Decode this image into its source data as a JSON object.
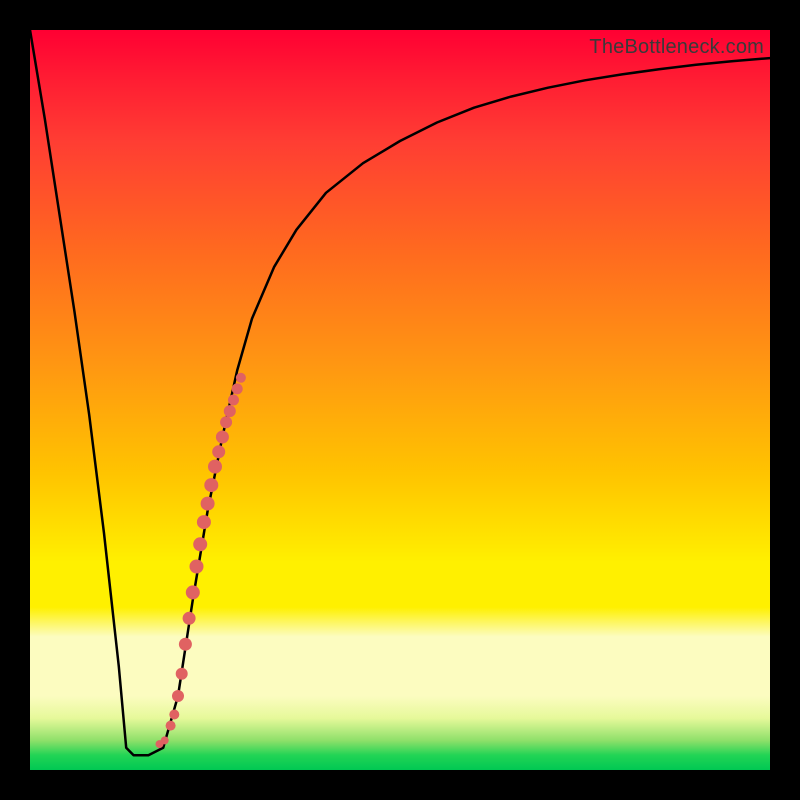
{
  "attribution": "TheBottleneck.com",
  "colors": {
    "frame": "#000000",
    "curve": "#000000",
    "points": "#e06262",
    "gradient_top": "#ff0033",
    "gradient_bottom": "#00c853"
  },
  "chart_data": {
    "type": "line",
    "title": "",
    "xlabel": "",
    "ylabel": "",
    "xlim": [
      0,
      100
    ],
    "ylim": [
      0,
      100
    ],
    "grid": false,
    "legend": false,
    "annotations": [
      "TheBottleneck.com"
    ],
    "series": [
      {
        "name": "bottleneck-curve",
        "x": [
          0,
          2,
          4,
          6,
          8,
          10,
          12,
          13,
          14,
          16,
          18,
          20,
          22,
          24,
          26,
          28,
          30,
          33,
          36,
          40,
          45,
          50,
          55,
          60,
          65,
          70,
          75,
          80,
          85,
          90,
          95,
          100
        ],
        "y": [
          100,
          88,
          75,
          62,
          48,
          32,
          14,
          3,
          2,
          2,
          3,
          10,
          23,
          35,
          45,
          54,
          61,
          68,
          73,
          78,
          82,
          85,
          87.5,
          89.5,
          91,
          92.2,
          93.2,
          94,
          94.7,
          95.3,
          95.8,
          96.2
        ]
      }
    ],
    "points": {
      "name": "highlight-points",
      "color": "#e06262",
      "x": [
        17.5,
        18.2,
        19.0,
        19.5,
        20.0,
        20.5,
        21.0,
        21.5,
        22.0,
        22.5,
        23.0,
        23.5,
        24.0,
        24.5,
        25.0,
        25.5,
        26.0,
        26.5,
        27.0,
        27.5,
        28.0,
        28.5
      ],
      "y": [
        3.5,
        4.0,
        6.0,
        7.5,
        10.0,
        13.0,
        17.0,
        20.5,
        24.0,
        27.5,
        30.5,
        33.5,
        36.0,
        38.5,
        41.0,
        43.0,
        45.0,
        47.0,
        48.5,
        50.0,
        51.5,
        53.0
      ],
      "r": [
        4,
        4,
        5,
        5,
        6,
        6,
        6.5,
        6.5,
        7,
        7,
        7,
        7,
        7,
        7,
        7,
        6.5,
        6.5,
        6,
        6,
        5.5,
        5.5,
        5
      ]
    }
  }
}
